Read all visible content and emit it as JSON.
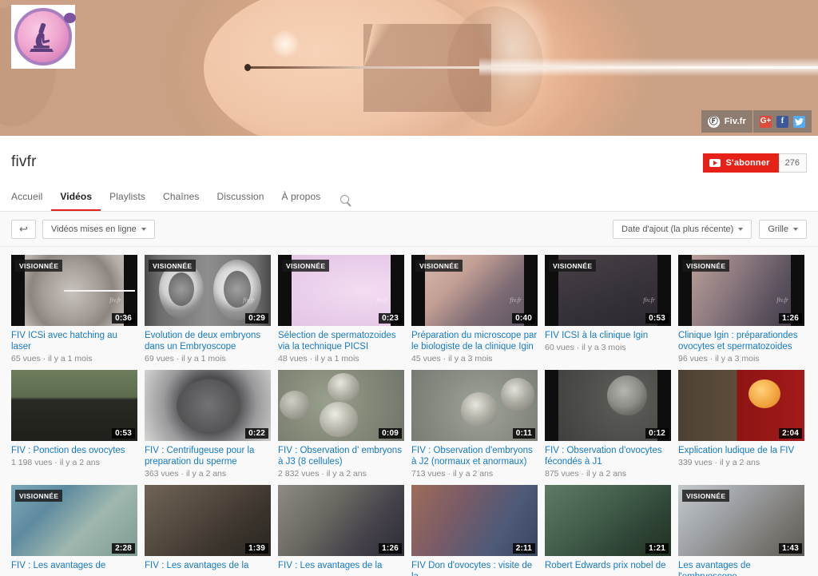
{
  "channel": {
    "name": "fivfr",
    "avatar_icon": "microscope-icon",
    "subscribe_label": "S'abonner",
    "subscriber_count": "276",
    "banner_links": [
      {
        "label": "Fiv.fr",
        "icon": "fivfr-logo-icon"
      },
      {
        "label": "",
        "icon": "google-plus-icon"
      },
      {
        "label": "",
        "icon": "facebook-icon"
      },
      {
        "label": "",
        "icon": "twitter-icon"
      }
    ],
    "social_glyphs": {
      "gplus": "G+",
      "facebook": "f",
      "twitter": "t",
      "fivfr": "Ⓕ"
    }
  },
  "nav": {
    "tabs": [
      {
        "label": "Accueil",
        "active": false
      },
      {
        "label": "Vidéos",
        "active": true
      },
      {
        "label": "Playlists",
        "active": false
      },
      {
        "label": "Chaînes",
        "active": false
      },
      {
        "label": "Discussion",
        "active": false
      },
      {
        "label": "À propos",
        "active": false
      }
    ],
    "search_icon": "search-icon"
  },
  "toolbar": {
    "back_glyph": "↩",
    "filter_label": "Vidéos mises en ligne",
    "sort_label": "Date d'ajout (la plus récente)",
    "view_label": "Grille"
  },
  "labels": {
    "watched_badge": "VISIONNÉE",
    "watermark": "fiv.fr"
  },
  "colors": {
    "accent_red": "#e62117",
    "link_blue": "#167ac6",
    "meta_gray": "#888888",
    "page_bg": "#f9f9f9"
  },
  "videos": [
    [
      {
        "title": "FIV ICSi avec hatching au laser",
        "views": "65 vues",
        "age": "il y a 1 mois",
        "duration": "0:36",
        "watched": true,
        "art": "t-icsi",
        "watermark": true
      },
      {
        "title": "Evolution de deux embryons dans un Embryoscope",
        "views": "69 vues",
        "age": "il y a 1 mois",
        "duration": "0:29",
        "watched": true,
        "art": "t-embryo2",
        "watermark": true
      },
      {
        "title": "Sélection de spermatozoides via la technique PICSI",
        "views": "48 vues",
        "age": "il y a 1 mois",
        "duration": "0:23",
        "watched": true,
        "art": "t-picsi",
        "watermark": true
      },
      {
        "title": "Préparation du microscope par le biologiste de la clinique Igin",
        "views": "45 vues",
        "age": "il y a 3 mois",
        "duration": "0:40",
        "watched": true,
        "art": "t-micro",
        "watermark": true
      },
      {
        "title": "FIV ICSI à la clinique Igin",
        "views": "60 vues",
        "age": "il y a 3 mois",
        "duration": "0:53",
        "watched": true,
        "art": "t-icsilab",
        "watermark": true
      },
      {
        "title": "Clinique Igin : préparationdes ovocytes et spermatozoides po…",
        "views": "96 vues",
        "age": "il y a 3 mois",
        "duration": "1:26",
        "watched": true,
        "art": "t-lab2",
        "watermark": true
      }
    ],
    [
      {
        "title": "FIV : Ponction des ovocytes",
        "views": "1 198 vues",
        "age": "il y a 2 ans",
        "duration": "0:53",
        "watched": false,
        "art": "t-petri",
        "watermark": false
      },
      {
        "title": "FIV : Centrifugeuse pour la preparation du sperme",
        "views": "363 vues",
        "age": "il y a 2 ans",
        "duration": "0:22",
        "watched": false,
        "art": "t-centri",
        "watermark": false
      },
      {
        "title": "FIV : Observation d' embryons à J3 (8 cellules)",
        "views": "2 832 vues",
        "age": "il y a 2 ans",
        "duration": "0:09",
        "watched": false,
        "art": "t-j3",
        "watermark": false
      },
      {
        "title": "FIV : Observation d'embryons à J2 (normaux et anormaux)",
        "views": "713 vues",
        "age": "il y a 2 ans",
        "duration": "0:11",
        "watched": false,
        "art": "t-j2",
        "watermark": false
      },
      {
        "title": "FIV : Observation d'ovocytes fécondés à J1",
        "views": "875 vues",
        "age": "il y a 2 ans",
        "duration": "0:12",
        "watched": false,
        "art": "t-j1",
        "watermark": false
      },
      {
        "title": "Explication ludique de la FIV",
        "views": "339 vues",
        "age": "il y a 2 ans",
        "duration": "2:04",
        "watched": false,
        "art": "t-ludique",
        "watermark": false
      }
    ],
    [
      {
        "title": "FIV : Les avantages de",
        "views": "",
        "age": "",
        "duration": "2:28",
        "watched": true,
        "art": "t-screens",
        "watermark": false
      },
      {
        "title": "FIV : Les avantages de la",
        "views": "",
        "age": "",
        "duration": "1:39",
        "watched": false,
        "art": "t-micro2",
        "watermark": false
      },
      {
        "title": "FIV : Les avantages de la",
        "views": "",
        "age": "",
        "duration": "1:26",
        "watched": false,
        "art": "t-lab3",
        "watermark": false
      },
      {
        "title": "FIV Don d'ovocytes : visite de la",
        "views": "",
        "age": "",
        "duration": "2:11",
        "watched": false,
        "art": "t-don",
        "watermark": false
      },
      {
        "title": "Robert Edwards prix nobel de",
        "views": "",
        "age": "",
        "duration": "1:21",
        "watched": false,
        "art": "t-nobel",
        "watermark": false
      },
      {
        "title": "Les avantages de l'embryoscope",
        "views": "",
        "age": "",
        "duration": "1:43",
        "watched": true,
        "art": "t-embsc",
        "watermark": false
      }
    ]
  ]
}
